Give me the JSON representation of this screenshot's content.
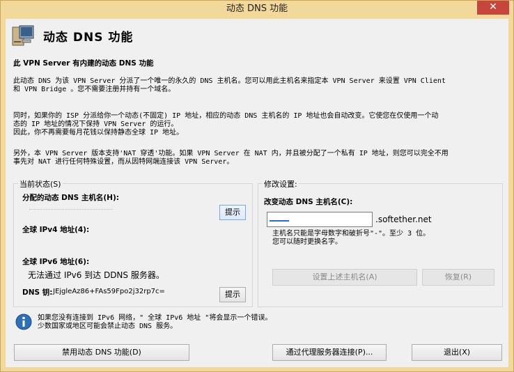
{
  "window": {
    "title": "动态 DNS 功能",
    "close_glyph": "✕"
  },
  "header": {
    "title": "动态 DNS 功能"
  },
  "intro": {
    "heading": "此 VPN Server 有内建的动态 DNS 功能",
    "p1_line1": "此动态 DNS 为该 VPN Server 分派了一个唯一的永久的 DNS 主机名。您可以用此主机名来指定本 VPN Server 来设置 VPN Client",
    "p1_line2": "和 VPN Bridge 。您不需要注册并持有一个域名。",
    "p2_line1": "同时，如果你的 ISP 分派给你一个动态(不固定) IP 地址，相应的动态 DNS 主机名的 IP 地址也会自动改变。它使您在仅使用一个动",
    "p2_line2": "态的 IP 地址的情况下保持 VPN Server 的运行。",
    "p2_line3": "因此，你不再需要每月花钱以保持静态全球 IP 地址。",
    "p3_line1": "另外，本 VPN Server 版本支持'NAT 穿透'功能。如果 VPN Server 在 NAT 内，并且被分配了一个私有 IP 地址，则您可以完全不用",
    "p3_line2": "事先对 NAT 进行任何特殊设置，而从因特网端连接该 VPN Server。"
  },
  "current_status": {
    "legend": "当前状态(S)",
    "hostname_label": "分配的动态 DNS 主机名(H):",
    "hint_button": "提示",
    "ipv4_label": "全球 IPv4 地址(4):",
    "ipv6_label": "全球 IPv6 地址(6):",
    "ipv6_value": "无法通过 IPv6 到达 DDNS 服务器。",
    "dns_key_label": "DNS 钥:",
    "dns_key_value": "JEjgleAz86+FAs59Fpo2j32rp7c=",
    "hint_button2": "提示"
  },
  "modify": {
    "legend": "修改设置:",
    "change_label": "改变动态 DNS 主机名(C):",
    "input_value": "",
    "domain_suffix": ".softether.net",
    "note_line1": "主机名只能是字母数字和破折号\"-\"。至少 3 位。",
    "note_line2": "您可以随时更换名字。",
    "set_button": "设置上述主机名(A)",
    "restore_button": "恢复(R)"
  },
  "info": {
    "line1": "如果您没有连接到 IPv6 网络，\" 全球 IPv6 地址 \"将会显示一个错误。",
    "line2": "少数国家或地区可能会禁止动态 DNS 服务。"
  },
  "footer": {
    "disable_button": "禁用动态 DNS 功能(D)",
    "proxy_button": "通过代理服务器连接(P)...",
    "exit_button": "退出(X)"
  },
  "colors": {
    "titlebar": "#f2d89a",
    "close": "#c7463c",
    "accent_border": "#7aa6d8"
  }
}
